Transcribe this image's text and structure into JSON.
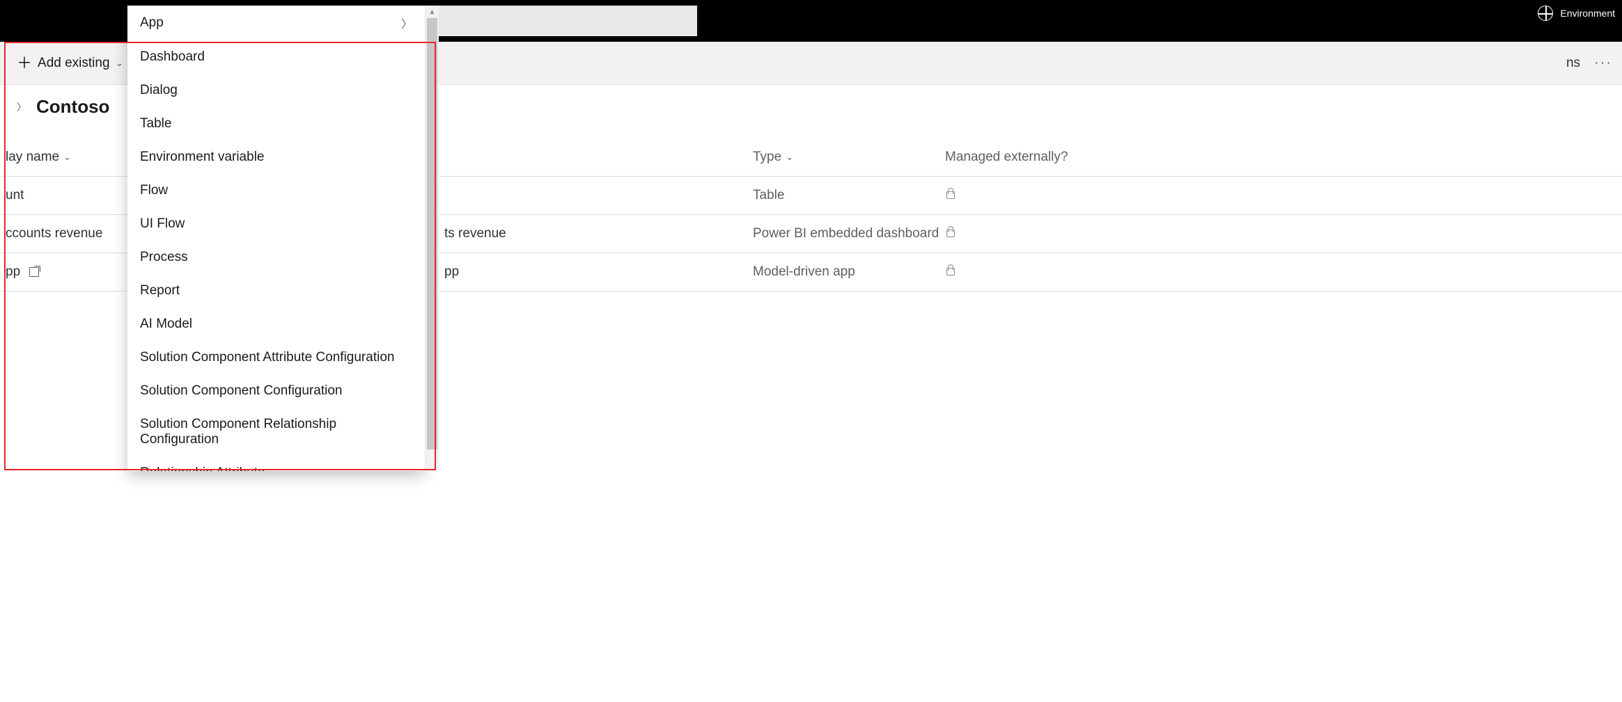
{
  "topbar": {
    "env_label": "Environment"
  },
  "cmdbar": {
    "add_existing": "Add existing",
    "trailing_fragment": "ns"
  },
  "solution": {
    "title": "Contoso"
  },
  "columns": {
    "name": "lay name",
    "type": "Type",
    "managed": "Managed externally?"
  },
  "rows": [
    {
      "name_fragment": "unt",
      "name_right_fragment": "",
      "type": "Table",
      "locked": true,
      "external": false
    },
    {
      "name_fragment": "ccounts revenue",
      "name_right_fragment": "ts revenue",
      "type": "Power BI embedded dashboard",
      "locked": true,
      "external": false
    },
    {
      "name_fragment": "pp",
      "name_right_fragment": "pp",
      "type": "Model-driven app",
      "locked": true,
      "external": true
    }
  ],
  "menu": {
    "items": [
      {
        "label": "App",
        "has_submenu": true
      },
      {
        "label": "Dashboard"
      },
      {
        "label": "Dialog"
      },
      {
        "label": "Table"
      },
      {
        "label": "Environment variable"
      },
      {
        "label": "Flow"
      },
      {
        "label": "UI Flow"
      },
      {
        "label": "Process"
      },
      {
        "label": "Report"
      },
      {
        "label": "AI Model"
      },
      {
        "label": "Solution Component Attribute Configuration"
      },
      {
        "label": "Solution Component Configuration"
      },
      {
        "label": "Solution Component Relationship Configuration"
      },
      {
        "label": "Relationship Attribute"
      }
    ]
  }
}
